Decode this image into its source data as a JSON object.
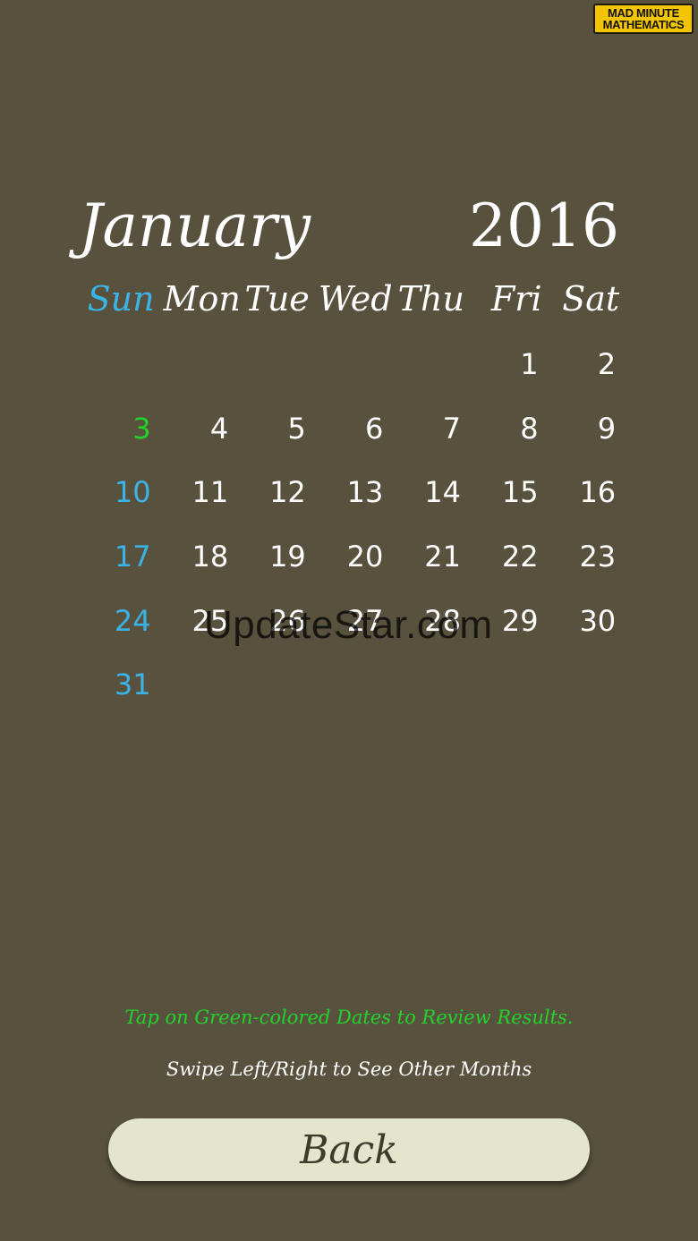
{
  "logo": {
    "line1": "MAD MINUTE",
    "line2": "MATHEMATICS"
  },
  "calendar": {
    "month": "January",
    "year": "2016",
    "weekdays": [
      "Sun",
      "Mon",
      "Tue",
      "Wed",
      "Thu",
      "Fri",
      "Sat"
    ],
    "weeks": [
      [
        "",
        "",
        "",
        "",
        "",
        "1",
        "2"
      ],
      [
        "3",
        "4",
        "5",
        "6",
        "7",
        "8",
        "9"
      ],
      [
        "10",
        "11",
        "12",
        "13",
        "14",
        "15",
        "16"
      ],
      [
        "17",
        "18",
        "19",
        "20",
        "21",
        "22",
        "23"
      ],
      [
        "24",
        "25",
        "26",
        "27",
        "28",
        "29",
        "30"
      ],
      [
        "31",
        "",
        "",
        "",
        "",
        "",
        ""
      ]
    ],
    "green_dates": [
      "3"
    ]
  },
  "watermark": "UpdateStar.com",
  "hints": {
    "review": "Tap on Green-colored Dates to Review Results.",
    "swipe": "Swipe Left/Right to See Other Months"
  },
  "back_button": {
    "label": "Back"
  },
  "colors": {
    "background": "#58513e",
    "sunday": "#3cb3e6",
    "green": "#21d32c",
    "button": "#e3e6cc"
  }
}
